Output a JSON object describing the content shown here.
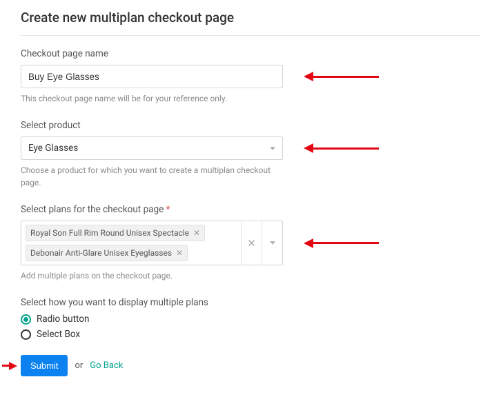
{
  "title": "Create new multiplan checkout page",
  "checkoutPage": {
    "label": "Checkout page name",
    "value": "Buy Eye Glasses",
    "helper": "This checkout page name will be for your reference only."
  },
  "product": {
    "label": "Select product",
    "selected": "Eye Glasses",
    "helper": "Choose a product for which you want to create a multiplan checkout page."
  },
  "plans": {
    "label": "Select plans for the checkout page",
    "required": "*",
    "tags": [
      "Royal Son Full Rim Round Unisex Spectacle",
      "Debonair Anti-Glare Unisex Eyeglasses"
    ],
    "helper": "Add multiple plans on the checkout page."
  },
  "display": {
    "label": "Select how you want to display multiple plans",
    "options": [
      {
        "label": "Radio button",
        "selected": true
      },
      {
        "label": "Select Box",
        "selected": false
      }
    ]
  },
  "actions": {
    "submit": "Submit",
    "or": "or",
    "goBack": "Go Back"
  }
}
